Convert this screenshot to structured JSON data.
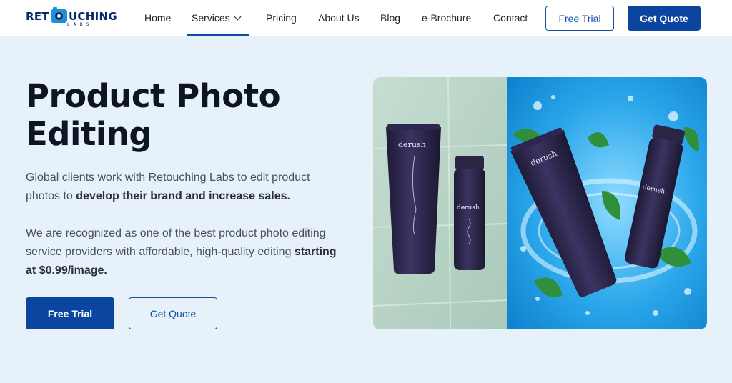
{
  "logo": {
    "wordmark_left": "RET",
    "wordmark_right": "UCHING",
    "tagline": "LABS"
  },
  "nav": {
    "items": [
      {
        "label": "Home"
      },
      {
        "label": "Services"
      },
      {
        "label": "Pricing"
      },
      {
        "label": "About Us"
      },
      {
        "label": "Blog"
      },
      {
        "label": "e-Brochure"
      },
      {
        "label": "Contact"
      }
    ],
    "active": "Services",
    "free_trial_label": "Free Trial",
    "get_quote_label": "Get Quote"
  },
  "hero": {
    "title_line1": "Product Photo",
    "title_line2": "Editing",
    "p1_text": "Global clients work with Retouching Labs to edit product photos to ",
    "p1_bold": "develop their brand and increase sales.",
    "p2_text": "We are recognized as one of the best product photo editing service providers with affordable, high-quality editing ",
    "p2_bold": "starting at $0.99/image.",
    "free_trial_label": "Free Trial",
    "get_quote_label": "Get Quote"
  },
  "image": {
    "product_brand": "dɵrush",
    "before_bg": "#b9d5c8",
    "after_bg": "#1c9be0",
    "product_color": "#2a2545"
  },
  "colors": {
    "primary": "#0b45a0",
    "page_bg": "#e6f1fa",
    "heading": "#0d1525"
  }
}
